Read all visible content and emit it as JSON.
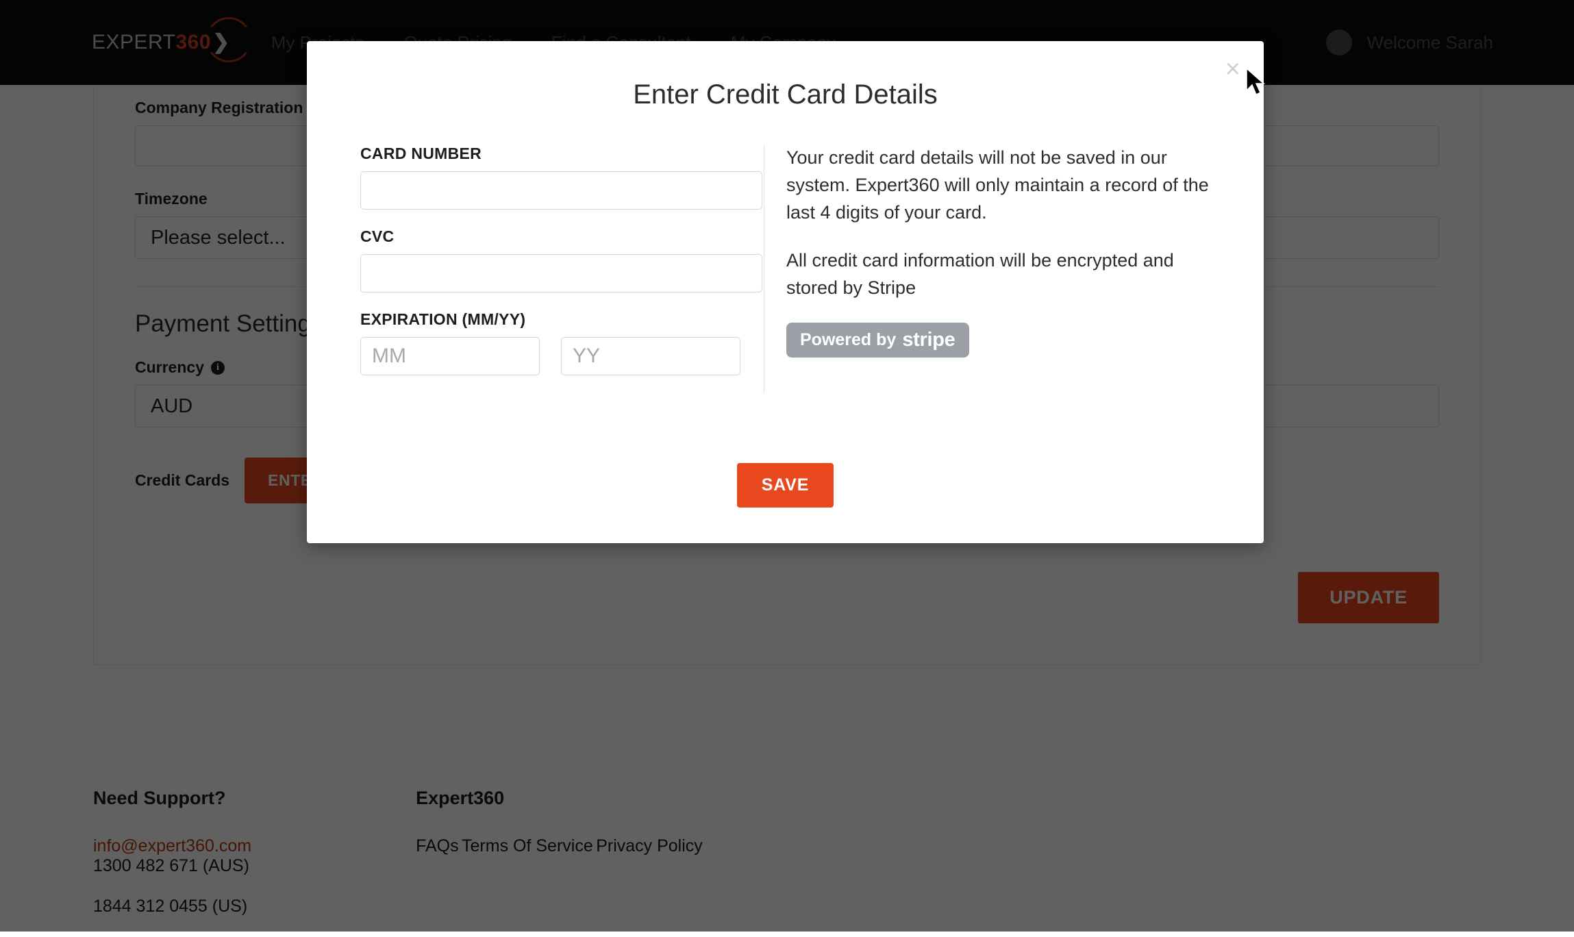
{
  "accent_color": "#e8481e",
  "topbar": {
    "logo": {
      "prefix": "EXPERT",
      "highlight": "360",
      "caret": "❯"
    },
    "nav_items": [
      {
        "label": "My Projects"
      },
      {
        "label": "Quote Pricing"
      },
      {
        "label": "Find a Consultant"
      },
      {
        "label": "My Company"
      }
    ],
    "welcome_label": "Welcome Sarah"
  },
  "settings_form": {
    "company_registration_label": "Company Registration Number",
    "company_registration_value": "",
    "timezone_label": "Timezone",
    "timezone_value": "Please select...",
    "payment_section_title": "Payment Settings",
    "currency_label": "Currency",
    "currency_info_icon": "info-icon",
    "currency_value": "AUD",
    "credit_cards_label": "Credit Cards",
    "enter_card_button": "ENTER CREDIT CARD DETAILS",
    "update_button": "UPDATE"
  },
  "modal": {
    "title": "Enter Credit Card Details",
    "close_icon": "×",
    "card_number_label": "CARD NUMBER",
    "card_number_value": "",
    "card_number_placeholder": "",
    "cvc_label": "CVC",
    "cvc_value": "",
    "cvc_placeholder": "",
    "expiration_label": "EXPIRATION (MM/YY)",
    "expiration_month_placeholder": "MM",
    "expiration_month_value": "",
    "expiration_year_placeholder": "YY",
    "expiration_year_value": "",
    "info_paragraph_1": "Your credit card details will not be saved in our system. Expert360 will only maintain a record of the last 4 digits of your card.",
    "info_paragraph_2": "All credit card information will be encrypted and stored by Stripe",
    "stripe_badge_prefix": "Powered by",
    "stripe_badge_brand": "stripe",
    "save_button": "SAVE"
  },
  "footer": {
    "support_title": "Need Support?",
    "support_email": "info@expert360.com",
    "support_phone_aus": "1300 482 671 (AUS)",
    "support_phone_us": "1844 312 0455 (US)",
    "company_title": "Expert360",
    "links": [
      {
        "label": "FAQs"
      },
      {
        "label": "Terms Of Service"
      },
      {
        "label": "Privacy Policy"
      }
    ]
  }
}
